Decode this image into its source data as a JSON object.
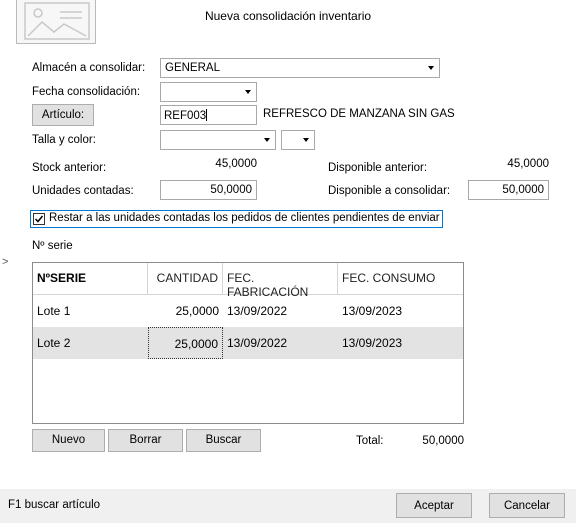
{
  "window": {
    "title": "Nueva consolidación inventario"
  },
  "header_icon": "image-placeholder-icon",
  "form": {
    "almacen_label": "Almacén a consolidar:",
    "almacen_value": "GENERAL",
    "fecha_label": "Fecha consolidación:",
    "fecha_value": "",
    "articulo_button": "Artículo:",
    "articulo_code": "REF003",
    "articulo_desc": "REFRESCO DE MANZANA SIN GAS",
    "talla_label": "Talla y color:",
    "talla_value": "",
    "color_value": "",
    "stock_label": "Stock anterior:",
    "stock_value": "45,0000",
    "disp_ant_label": "Disponible anterior:",
    "disp_ant_value": "45,0000",
    "unidades_label": "Unidades contadas:",
    "unidades_value": "50,0000",
    "disp_cons_label": "Disponible a consolidar:",
    "disp_cons_value": "50,0000",
    "restar_label": "Restar a las unidades contadas los pedidos de clientes pendientes de enviar",
    "restar_checked": true,
    "serie_label": "Nº serie"
  },
  "grid": {
    "columns": [
      "NºSERIE",
      "CANTIDAD",
      "FEC. FABRICACIÓN",
      "FEC. CONSUMO"
    ],
    "rows": [
      {
        "serie": "Lote 1",
        "cantidad": "25,0000",
        "fabricacion": "13/09/2022",
        "consumo": "13/09/2023"
      },
      {
        "serie": "Lote 2",
        "cantidad": "25,0000",
        "fabricacion": "13/09/2022",
        "consumo": "13/09/2023"
      }
    ],
    "selected_row": 1
  },
  "grid_buttons": {
    "nuevo": "Nuevo",
    "borrar": "Borrar",
    "buscar": "Buscar"
  },
  "total": {
    "label": "Total:",
    "value": "50,0000"
  },
  "side_marker": ">",
  "status": {
    "hint": "F1 buscar artículo"
  },
  "footer": {
    "aceptar": "Aceptar",
    "cancelar": "Cancelar"
  },
  "colors": {
    "accent": "#0078d7",
    "selected_row_bg": "#e3e3e3",
    "status_bg": "#f0f0f0",
    "button_bg": "#e1e1e1"
  }
}
